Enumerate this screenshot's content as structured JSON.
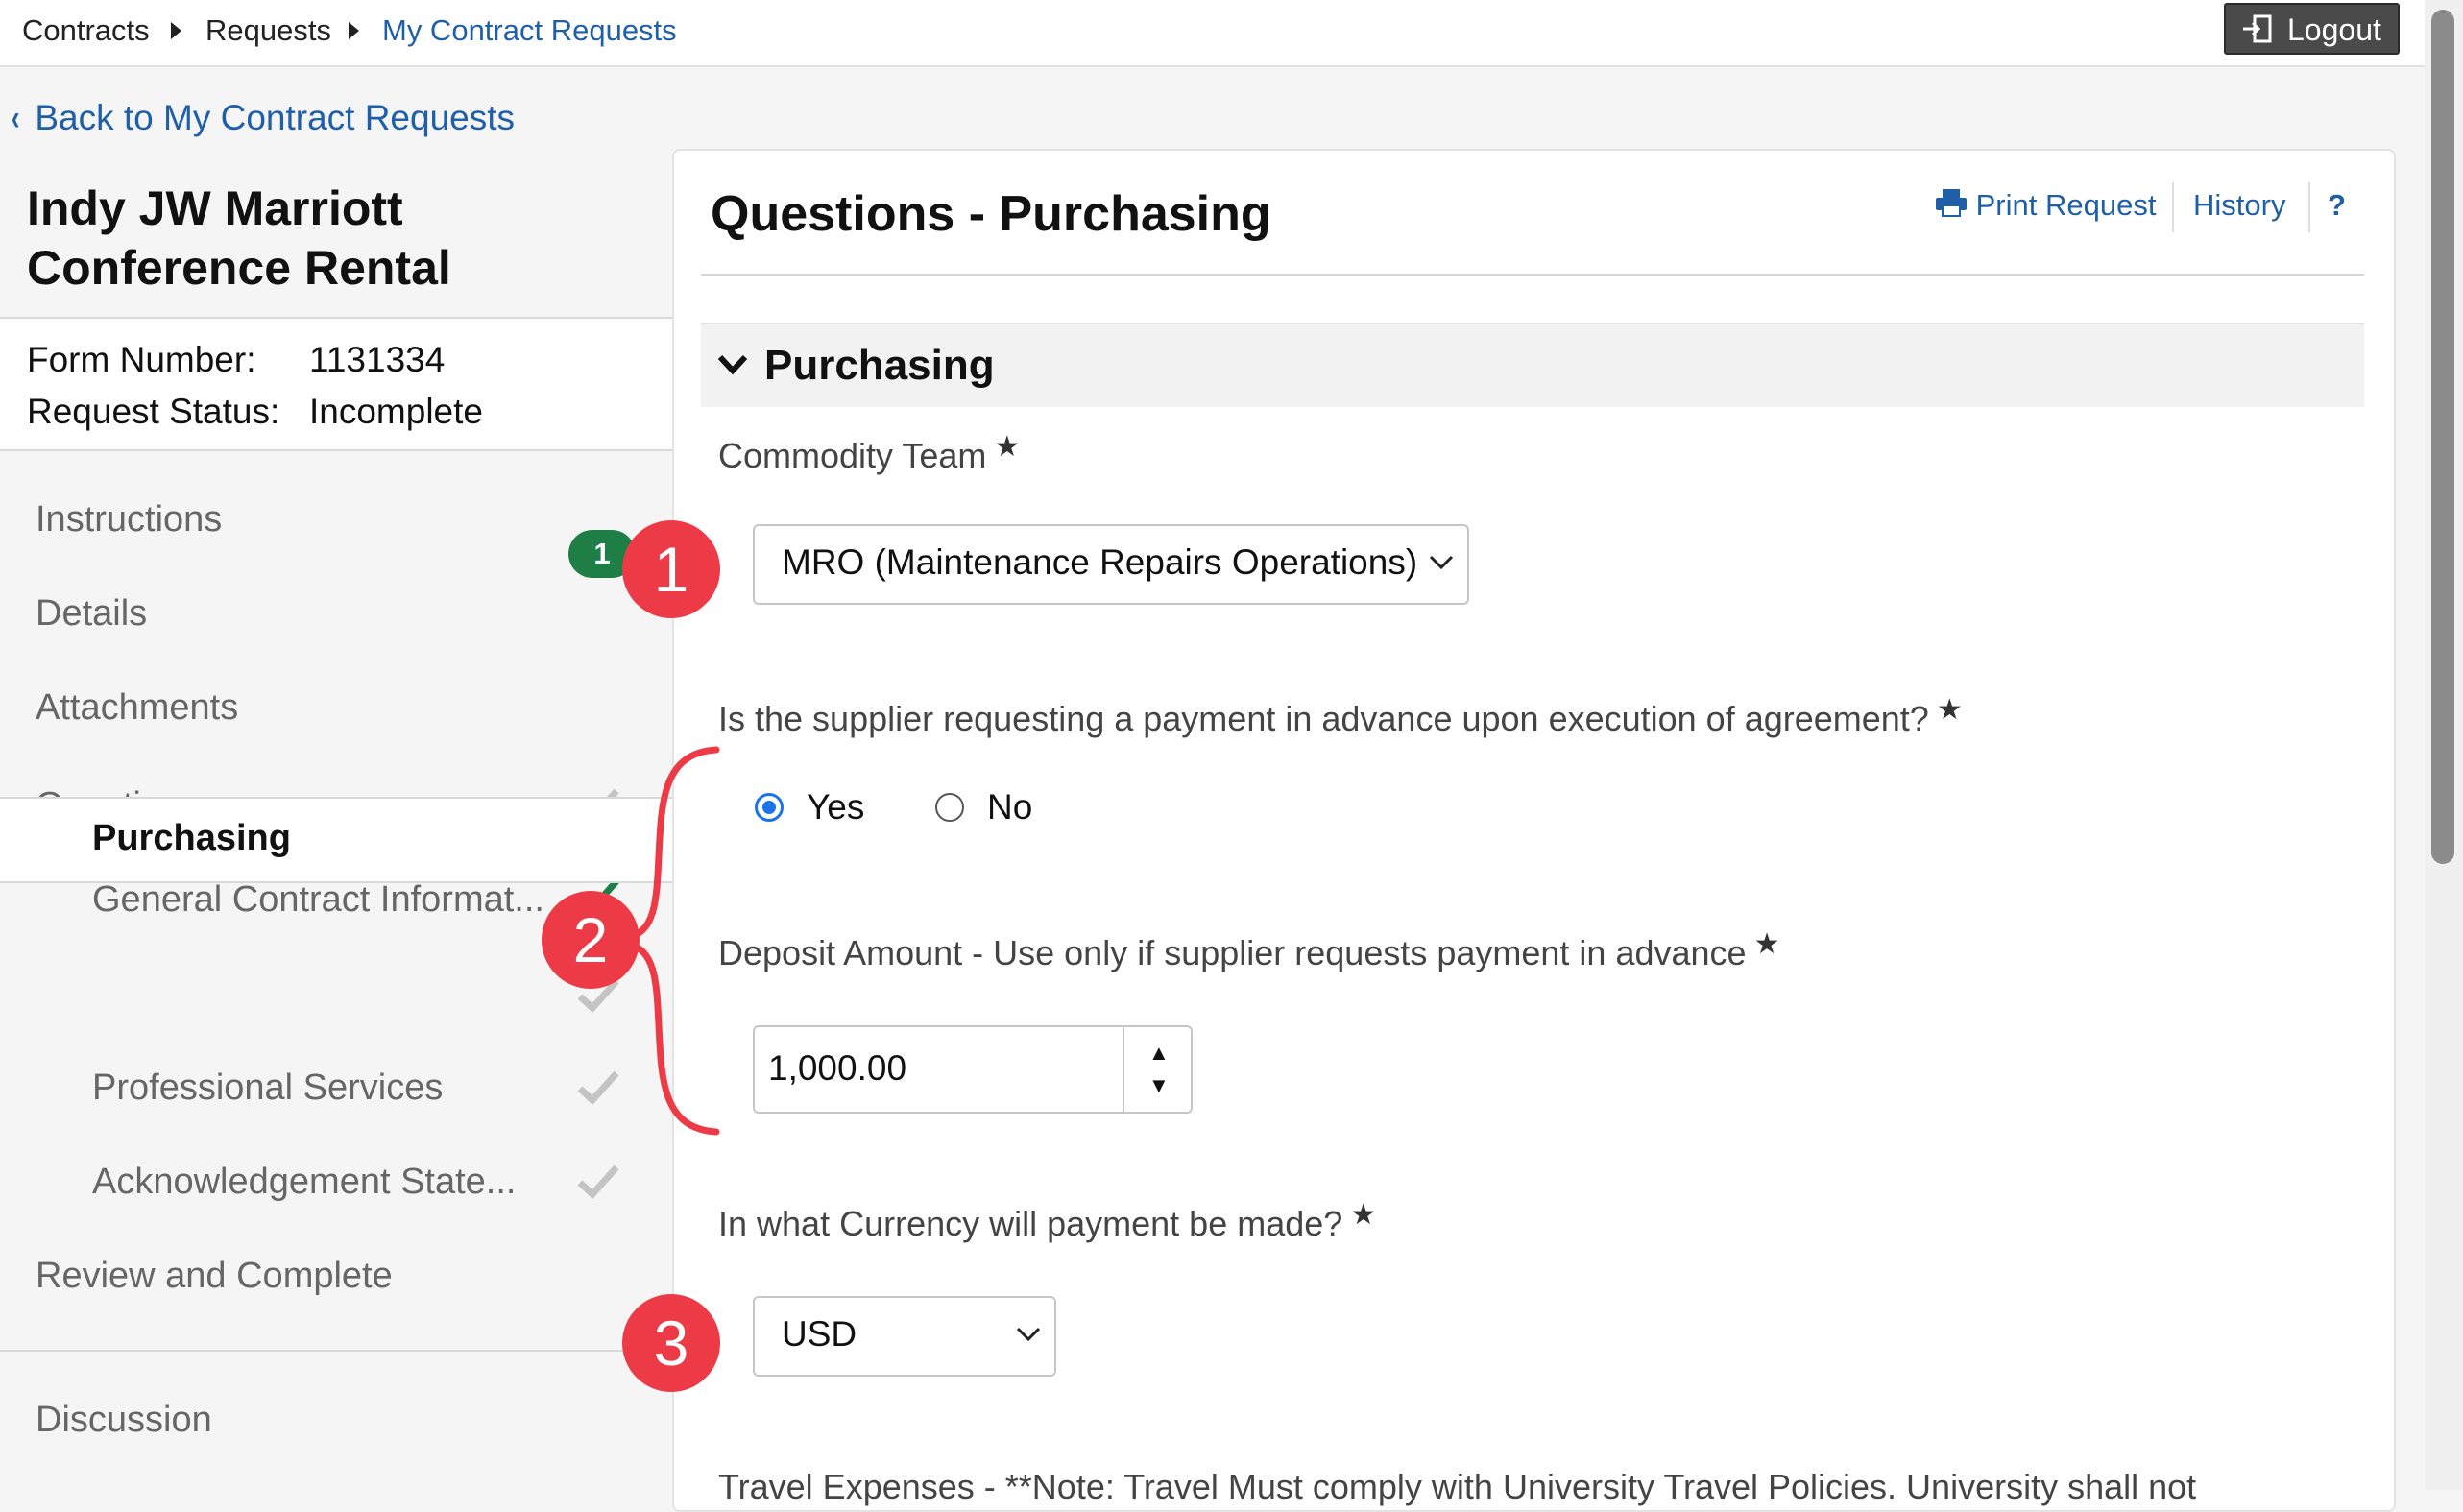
{
  "breadcrumb": {
    "items": [
      "Contracts",
      "Requests",
      "My Contract Requests"
    ]
  },
  "header": {
    "logout_label": "Logout"
  },
  "back_link": "Back to My Contract Requests",
  "request": {
    "title_line1": "Indy JW Marriott",
    "title_line2": "Conference Rental",
    "form_number_label": "Form Number:",
    "form_number": "1131334",
    "status_label": "Request Status:",
    "status": "Incomplete"
  },
  "sidebar": {
    "items": [
      {
        "label": "Instructions"
      },
      {
        "label": "Details"
      },
      {
        "label": "Attachments",
        "badge": "1"
      },
      {
        "label": "Questions"
      },
      {
        "label": "General Contract Informat..."
      },
      {
        "label": "Purchasing"
      },
      {
        "label": "Professional Services"
      },
      {
        "label": "Acknowledgement State..."
      },
      {
        "label": "Review and Complete"
      },
      {
        "label": "Discussion"
      }
    ]
  },
  "main": {
    "title": "Questions - Purchasing",
    "print_label": "Print Request",
    "history_label": "History",
    "help_label": "?",
    "section_title": "Purchasing",
    "commodity": {
      "label": "Commodity Team",
      "required_mark": "★",
      "value": "MRO (Maintenance Repairs Operations)"
    },
    "advance_payment": {
      "label": "Is the supplier requesting a payment in advance upon execution of agreement?",
      "required_mark": "★",
      "options": [
        "Yes",
        "No"
      ],
      "selected": "Yes"
    },
    "deposit": {
      "label": "Deposit Amount - Use only if supplier requests payment in advance",
      "required_mark": "★",
      "value": "1,000.00"
    },
    "currency": {
      "label": "In what Currency will payment be made?",
      "required_mark": "★",
      "value": "USD"
    },
    "travel_partial": "Travel Expenses - **Note: Travel Must comply with University Travel Policies. University shall not"
  },
  "annotations": [
    "1",
    "2",
    "3"
  ],
  "colors": {
    "link": "#1f5fa8",
    "annotation": "#ec3b46",
    "badge": "#1e7e46",
    "radio_selected": "#1a73e8"
  }
}
